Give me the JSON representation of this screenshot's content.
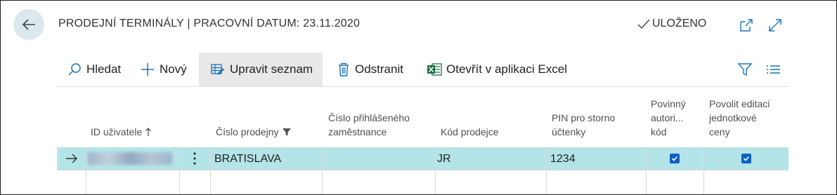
{
  "header": {
    "title": "PRODEJNÍ TERMINÁLY | PRACOVNÍ DATUM: 23.11.2020",
    "status": "ULOŽENO"
  },
  "toolbar": {
    "search_label": "Hledat",
    "new_label": "Nový",
    "edit_list_label": "Upravit seznam",
    "delete_label": "Odstranit",
    "excel_label": "Otevřít v aplikaci Excel"
  },
  "table": {
    "columns": {
      "user_id": "ID uživatele",
      "pos_number": "Číslo prodejny",
      "employee": [
        "Číslo přihlášeného",
        "zaměstnance"
      ],
      "salesperson": "Kód prodejce",
      "pin": [
        "PIN pro storno",
        "účtenky"
      ],
      "auth": [
        "Povinný",
        "autori...",
        "kód"
      ],
      "edit_price": [
        "Povolit editaci",
        "jednotkové",
        "ceny"
      ]
    },
    "rows": [
      {
        "pos_number": "BRATISLAVA",
        "employee": "",
        "salesperson": "JR",
        "pin": "1234",
        "auth": true,
        "edit_price": true
      }
    ]
  },
  "colors": {
    "accent": "#0f5ec9",
    "selected_row": "#b4e4e8",
    "back_button_bg": "#dbe9ee",
    "excel_green": "#1d7044"
  },
  "icons": [
    "back-arrow-icon",
    "checkmark-icon",
    "pop-out-icon",
    "expand-icon",
    "search-icon",
    "plus-icon",
    "edit-list-icon",
    "trash-icon",
    "excel-icon",
    "filter-icon",
    "list-view-icon",
    "sort-up-icon",
    "filter-funnel-icon",
    "row-arrow-icon",
    "row-menu-icon"
  ]
}
